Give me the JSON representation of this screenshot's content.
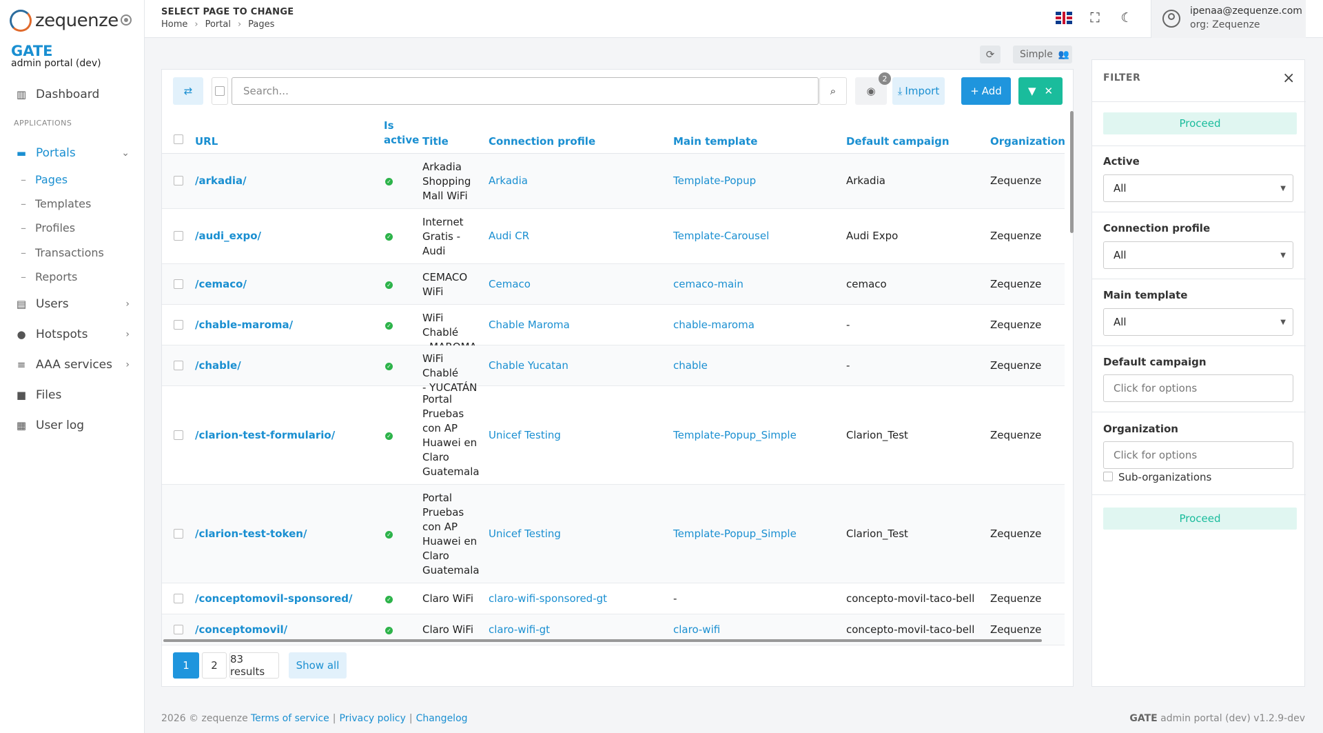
{
  "brand": {
    "logo_text": "zequenze",
    "app_name": "GATE",
    "app_subtitle": "admin portal (dev)"
  },
  "sidebar": {
    "dashboard": "Dashboard",
    "section_label": "APPLICATIONS",
    "portals": "Portals",
    "portal_subs": [
      "Pages",
      "Templates",
      "Profiles",
      "Transactions",
      "Reports"
    ],
    "users": "Users",
    "hotspots": "Hotspots",
    "aaa": "AAA services",
    "files": "Files",
    "userlog": "User log"
  },
  "header": {
    "page_title": "SELECT PAGE TO CHANGE",
    "breadcrumb": [
      "Home",
      "Portal",
      "Pages"
    ],
    "user_email": "ipenaa@zequenze.com",
    "user_org": "org: Zequenze"
  },
  "view": {
    "mode_label": "Simple"
  },
  "toolbar": {
    "search_placeholder": "Search...",
    "eye_badge": "2",
    "import_label": "Import",
    "add_label": "Add"
  },
  "table": {
    "columns": {
      "url": "URL",
      "is_active_1": "Is",
      "is_active_2": "active",
      "title": "Title",
      "connection_profile": "Connection profile",
      "main_template": "Main template",
      "default_campaign": "Default campaign",
      "organization": "Organization"
    },
    "rows": [
      {
        "url": "/arkadia/",
        "title_lines": [
          "Arkadia",
          "Shopping",
          "Mall WiFi"
        ],
        "profile": "Arkadia",
        "template": "Template-Popup",
        "campaign": "Arkadia",
        "org": "Zequenze"
      },
      {
        "url": "/audi_expo/",
        "title_lines": [
          "Internet",
          "Gratis -",
          "Audi"
        ],
        "profile": "Audi CR",
        "template": "Template-Carousel",
        "campaign": "Audi Expo",
        "org": "Zequenze"
      },
      {
        "url": "/cemaco/",
        "title_lines": [
          "CEMACO",
          "WiFi"
        ],
        "profile": "Cemaco",
        "template": "cemaco-main",
        "campaign": "cemaco",
        "org": "Zequenze"
      },
      {
        "url": "/chable-maroma/",
        "title_lines": [
          "WiFi Chablé",
          "- MAROMA"
        ],
        "profile": "Chable Maroma",
        "template": "chable-maroma",
        "campaign": "-",
        "org": "Zequenze"
      },
      {
        "url": "/chable/",
        "title_lines": [
          "WiFi Chablé",
          "- YUCATÁN"
        ],
        "profile": "Chable Yucatan",
        "template": "chable",
        "campaign": "-",
        "org": "Zequenze"
      },
      {
        "url": "/clarion-test-formulario/",
        "title_lines": [
          "Portal",
          "Pruebas",
          "con AP",
          "Huawei en",
          "Claro",
          "Guatemala"
        ],
        "profile": "Unicef Testing",
        "template": "Template-Popup_Simple",
        "campaign": "Clarion_Test",
        "org": "Zequenze"
      },
      {
        "url": "/clarion-test-token/",
        "title_lines": [
          "Portal",
          "Pruebas",
          "con AP",
          "Huawei en",
          "Claro",
          "Guatemala"
        ],
        "profile": "Unicef Testing",
        "template": "Template-Popup_Simple",
        "campaign": "Clarion_Test",
        "org": "Zequenze"
      },
      {
        "url": "/conceptomovil-sponsored/",
        "title_lines": [
          "Claro WiFi"
        ],
        "profile": "claro-wifi-sponsored-gt",
        "template": "-",
        "campaign": "concepto-movil-taco-bell",
        "org": "Zequenze"
      },
      {
        "url": "/conceptomovil/",
        "title_lines": [
          "Claro WiFi"
        ],
        "profile": "claro-wifi-gt",
        "template": "claro-wifi",
        "campaign": "concepto-movil-taco-bell",
        "org": "Zequenze"
      }
    ]
  },
  "pagination": {
    "pages": [
      "1",
      "2"
    ],
    "results": "83 results",
    "show_all": "Show all"
  },
  "filter": {
    "title": "FILTER",
    "proceed": "Proceed",
    "active_label": "Active",
    "active_value": "All",
    "profile_label": "Connection profile",
    "profile_value": "All",
    "template_label": "Main template",
    "template_value": "All",
    "campaign_label": "Default campaign",
    "campaign_placeholder": "Click for options",
    "org_label": "Organization",
    "org_placeholder": "Click for options",
    "suborg_label": "Sub-organizations"
  },
  "footer": {
    "copyright": "2026 © zequenze",
    "links": [
      "Terms of service",
      "Privacy policy",
      "Changelog"
    ],
    "version_brand": "GATE",
    "version_text": "admin portal (dev) v1.2.9-dev"
  },
  "colors": {
    "accent": "#1a8fd1",
    "success": "#1abc9c",
    "active_ok": "#2db34a"
  }
}
